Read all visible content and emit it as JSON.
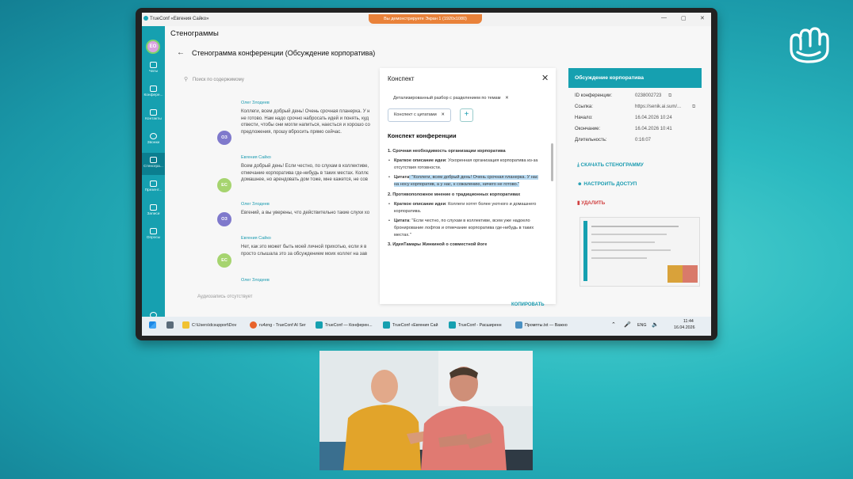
{
  "window": {
    "title": "TrueConf «Евгения Сайко»",
    "share_notice": "Вы демонстрируете Экран 1 (1920x1080)",
    "controls": [
      "—",
      "▢",
      "✕"
    ]
  },
  "user": {
    "initials": "ЕО"
  },
  "nav": [
    {
      "label": "Чаты"
    },
    {
      "label": "Конфере..."
    },
    {
      "label": "Контакты"
    },
    {
      "label": "Звонки"
    },
    {
      "label": "Стеногра...",
      "active": true
    },
    {
      "label": "Презент..."
    },
    {
      "label": "Записи"
    },
    {
      "label": "Опросы"
    },
    {
      "label": "Настрой..."
    }
  ],
  "page": {
    "title": "Стенограммы",
    "subtitle": "Стенограмма конференции (Обсуждение корпоратива)"
  },
  "transcript": {
    "search_placeholder": "Поиск по содержимому",
    "messages": [
      {
        "name": "Олег Злодеев",
        "initials": "ОЗ",
        "lines": [
          "Коллеги, всем добрый день! Очень срочная планерка. У н",
          "не готово. Нам надо срочно набросать идей и понять, куд",
          "отвести, чтобы они могли напиться, наесться и хорошо со",
          "предложения, прошу вбросить прямо сейчас."
        ]
      },
      {
        "name": "Евгения Сайко",
        "initials": "ЕС",
        "lines": [
          "Всем добрый день! Если честно, по слухам в коллективе,",
          "отмечание корпоратива где-нибудь в таких местах. Коллє",
          "домашнее, но арендовать дом тоже, мне кажется, не сов"
        ]
      },
      {
        "name": "Олег Злодеев",
        "initials": "ОЗ",
        "lines": [
          "Евгений, а вы уверены, что действительно такие слухи хо"
        ]
      },
      {
        "name": "Евгения Сайко",
        "initials": "ЕС",
        "lines": [
          "Нет, как это может быть моей личной прихотью, если я в",
          "просто слышала это за обсуждением моих коллег на зав"
        ]
      },
      {
        "name": "Олег Злодеев",
        "initials": "",
        "lines": []
      }
    ],
    "audio_note": "Аудиозапись отсутствует"
  },
  "summary_panel": {
    "title": "Конспект",
    "chip_detailed": "Детализированный разбор с разделением по темам",
    "chip_quotes": "Конспект с цитатами",
    "heading": "Конспект конференции",
    "sec1": "1. Срочная необходимость организации корпоратива",
    "s1_label1": "Краткое описание идеи",
    "s1_text1": ": Ускоренная организация корпоратива из-за отсутствия готовности.",
    "s1_label2": "Цитата",
    "s1_text2": ": \"Коллеги, всем добрый день! Очень срочная планерка. У нас на носу корпоратив, а у нас, к сожалению, ничего не готово.\"",
    "sec2": "2. Противоположное мнение о традиционных корпоративах",
    "s2_label1": "Краткое описание идеи",
    "s2_text1": ": Коллеги хотят более уютного и домашнего корпоратива.",
    "s2_label2": "Цитата",
    "s2_text2": ": \"Если честно, по слухам в коллективе, всем уже надоело бронирование лофтов и отмечание корпоратива где-нибудь в таких местах.\"",
    "sec3": "3. ИдеяТамары Жинкиной о совместной йоге",
    "copy_label": "КОПИРОВАТЬ"
  },
  "conference": {
    "title": "Обсуждение корпоратива",
    "rows": [
      {
        "label": "ID конференции:",
        "value": "0238002723"
      },
      {
        "label": "Ссылка:",
        "value": "https://senik.ai.sum/..."
      },
      {
        "label": "Начало:",
        "value": "16.04.2026 10:24"
      },
      {
        "label": "Окончание:",
        "value": "16.04.2026 10:41"
      },
      {
        "label": "Длительность:",
        "value": "0:16:07"
      }
    ],
    "download": "СКАЧАТЬ СТЕНОГРАММУ",
    "access": "НАСТРОИТЬ ДОСТУП",
    "delete": "УДАЛИТЬ"
  },
  "taskbar": {
    "items": [
      "C:\\Users\\dcsupport\\Dov",
      "ru4zng - TrueConf AI Ser",
      "TrueConf — Конферен...",
      "TrueConf «Евгения Сай",
      "TrueConf - Расширенн",
      "Промпты.txt — Важно"
    ],
    "lang": "ENG",
    "time": "11:44",
    "date": "16.04.2026"
  },
  "colors": {
    "accent": "#16a0b0",
    "share": "#e9823a",
    "danger": "#d04040"
  }
}
